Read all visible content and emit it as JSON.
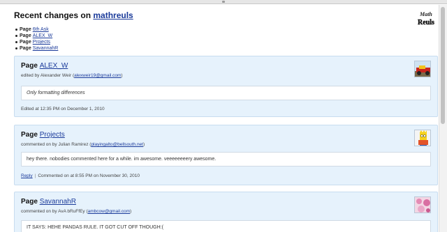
{
  "page": {
    "title_prefix": "Recent changes on",
    "site_name": "mathreuls",
    "logo_text_top": "Math",
    "logo_text_bottom": "Reuls"
  },
  "summary": [
    {
      "kind": "Page",
      "name": "6th Ask"
    },
    {
      "kind": "Page",
      "name": "ALEX_W"
    },
    {
      "kind": "Page",
      "name": "Projects"
    },
    {
      "kind": "Page",
      "name": "SavannahR"
    }
  ],
  "cards": [
    {
      "kind": "Page",
      "name": "ALEX_W",
      "byline_prefix": "edited by Alexander Weir (",
      "email": "alexweir19@gmail.com",
      "byline_suffix": ")",
      "content": "Only formatting differences",
      "footer": "Edited at 12:35 PM on December 1, 2010",
      "avatar": "racecar-avatar"
    },
    {
      "kind": "Page",
      "name": "Projects",
      "byline_prefix": "commented on by Julian Ramirez (",
      "email": "playingalto@bellsouth.net",
      "byline_suffix": ")",
      "content": "hey there. nobodies commented here for a while. im awesome. veeeeeeeery awesome.",
      "reply_label": "Reply",
      "footer": "Commented on at 8:55 PM on November 30, 2010",
      "avatar": "bart-avatar"
    },
    {
      "kind": "Page",
      "name": "SavannahR",
      "byline_prefix": "commented on by AvA bRuFfEy (",
      "email": "ambcow@gmail.com",
      "byline_suffix": ")",
      "content": "IT SAYS: HEHE PANDAS RULE. IT GOT CUT OFF THOUGH:(",
      "avatar": "pink-pattern-avatar"
    }
  ],
  "colors": {
    "link": "#1a3a9a",
    "card_bg": "#e6f2fc",
    "card_border": "#c7dcef"
  }
}
